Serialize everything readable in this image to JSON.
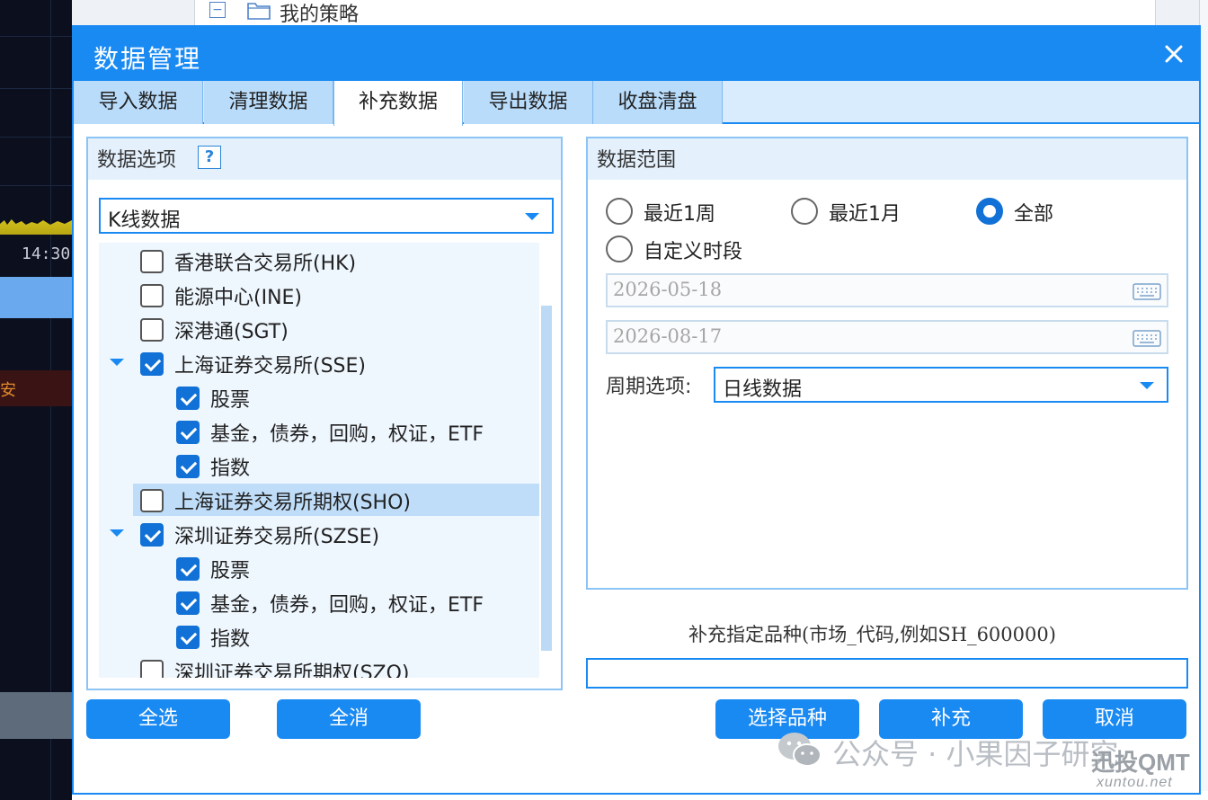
{
  "background": {
    "time_label": "14:30",
    "side_text": "安",
    "tree_item": "我的策略"
  },
  "dialog": {
    "title": "数据管理",
    "tabs": [
      {
        "label": "导入数据"
      },
      {
        "label": "清理数据"
      },
      {
        "label": "补充数据",
        "active": true
      },
      {
        "label": "导出数据"
      },
      {
        "label": "收盘清盘"
      }
    ]
  },
  "data_options": {
    "title": "数据选项",
    "help_label": "?",
    "data_type": "K线数据",
    "tree": [
      {
        "label": "香港联合交易所(HK)",
        "checked": false
      },
      {
        "label": "能源中心(INE)",
        "checked": false
      },
      {
        "label": "深港通(SGT)",
        "checked": false
      },
      {
        "label": "上海证券交易所(SSE)",
        "checked": true,
        "expanded": true
      },
      {
        "label": "股票",
        "checked": true
      },
      {
        "label": "基金，债券，回购，权证，ETF",
        "checked": true
      },
      {
        "label": "指数",
        "checked": true
      },
      {
        "label": "上海证券交易所期权(SHO)",
        "checked": false,
        "highlighted": true
      },
      {
        "label": "深圳证券交易所(SZSE)",
        "checked": true,
        "expanded": true
      },
      {
        "label": "股票",
        "checked": true
      },
      {
        "label": "基金，债券，回购，权证，ETF",
        "checked": true
      },
      {
        "label": "指数",
        "checked": true
      },
      {
        "label": "深圳证券交易所期权(SZO)",
        "checked": false
      }
    ]
  },
  "data_range": {
    "title": "数据范围",
    "options": [
      {
        "label": "最近1周",
        "selected": false
      },
      {
        "label": "最近1月",
        "selected": false
      },
      {
        "label": "全部",
        "selected": true
      },
      {
        "label": "自定义时段",
        "selected": false
      }
    ],
    "start_date": "2026-05-18",
    "end_date": "2026-08-17",
    "period_label": "周期选项:",
    "period_value": "日线数据"
  },
  "supplement": {
    "hint": "补充指定品种(市场_代码,例如SH_600000)",
    "value": ""
  },
  "buttons": {
    "select_all": "全选",
    "deselect_all": "全消",
    "choose_symbols": "选择品种",
    "supplement": "补充",
    "cancel": "取消"
  },
  "watermark": {
    "text": "公众号 · 小果因子研究",
    "logo": "迅投QMT",
    "site": "xuntou.net"
  },
  "colors": {
    "accent": "#1a8af3",
    "tab_bg": "#b9dcfb",
    "checkbox": "#1171d6"
  }
}
